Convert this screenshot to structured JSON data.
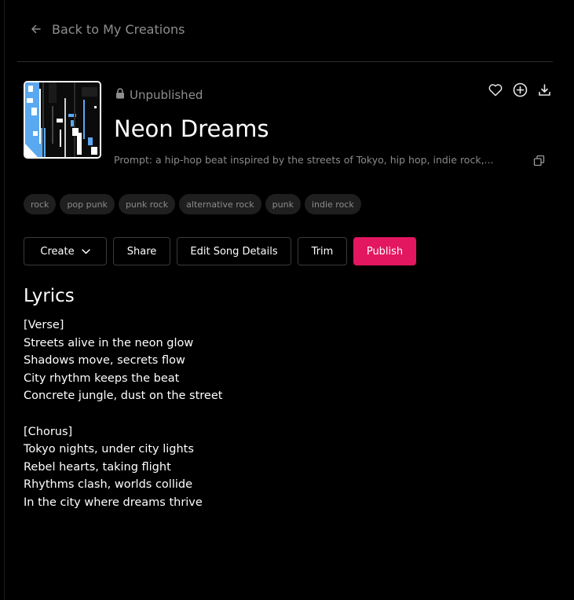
{
  "nav": {
    "back_label": "Back to My Creations",
    "back_icon": "arrow-left-icon"
  },
  "song": {
    "status": "Unpublished",
    "status_icon": "lock-icon",
    "title": "Neon Dreams",
    "prompt": "Prompt: a hip-hop beat inspired by the streets of Tokyo, hip hop, indie rock,...",
    "cover_icon": "album-cover",
    "tags": [
      "rock",
      "pop punk",
      "punk rock",
      "alternative rock",
      "punk",
      "indie rock"
    ]
  },
  "top_icons": [
    "heart-icon",
    "plus-circle-icon",
    "download-icon"
  ],
  "actions": {
    "create": "Create",
    "share": "Share",
    "edit": "Edit Song Details",
    "trim": "Trim",
    "publish": "Publish"
  },
  "lyrics": {
    "heading": "Lyrics",
    "lines": [
      "[Verse]",
      "Streets alive in the neon glow",
      "Shadows move, secrets flow",
      "City rhythm keeps the beat",
      "Concrete jungle, dust on the street",
      "",
      "[Chorus]",
      "Tokyo nights, under city lights",
      "Rebel hearts, taking flight",
      "Rhythms clash, worlds collide",
      "In the city where dreams thrive"
    ]
  },
  "colors": {
    "background": "#000000",
    "accent": "#e3175f",
    "muted_text": "#8e8e8e",
    "tag_bg": "#1f1f1f"
  }
}
